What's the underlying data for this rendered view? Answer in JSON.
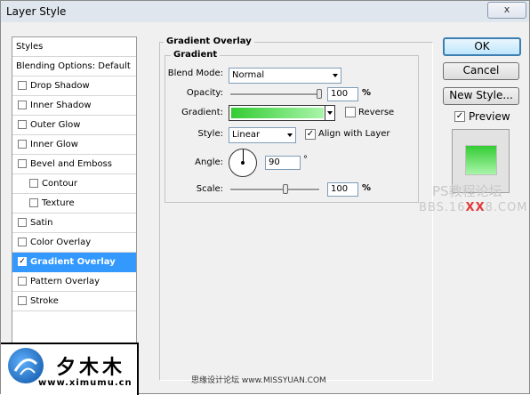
{
  "window": {
    "title": "Layer Style",
    "close_glyph": "x"
  },
  "styles_panel": {
    "items": [
      {
        "label": "Styles",
        "checkbox": false
      },
      {
        "label": "Blending Options: Default",
        "checkbox": false
      },
      {
        "label": "Drop Shadow",
        "checkbox": true,
        "checked": false
      },
      {
        "label": "Inner Shadow",
        "checkbox": true,
        "checked": false
      },
      {
        "label": "Outer Glow",
        "checkbox": true,
        "checked": false
      },
      {
        "label": "Inner Glow",
        "checkbox": true,
        "checked": false
      },
      {
        "label": "Bevel and Emboss",
        "checkbox": true,
        "checked": false
      },
      {
        "label": "Contour",
        "checkbox": true,
        "checked": false,
        "indent": true
      },
      {
        "label": "Texture",
        "checkbox": true,
        "checked": false,
        "indent": true
      },
      {
        "label": "Satin",
        "checkbox": true,
        "checked": false
      },
      {
        "label": "Color Overlay",
        "checkbox": true,
        "checked": false
      },
      {
        "label": "Gradient Overlay",
        "checkbox": true,
        "checked": true,
        "selected": true
      },
      {
        "label": "Pattern Overlay",
        "checkbox": true,
        "checked": false
      },
      {
        "label": "Stroke",
        "checkbox": true,
        "checked": false
      }
    ]
  },
  "gradient_overlay": {
    "section_title": "Gradient Overlay",
    "group_title": "Gradient",
    "blend_mode_label": "Blend Mode:",
    "blend_mode_value": "Normal",
    "opacity_label": "Opacity:",
    "opacity_value": "100",
    "opacity_unit": "%",
    "opacity_level": 1.0,
    "gradient_label": "Gradient:",
    "gradient_colors": [
      "#33cc33",
      "#aaf5aa"
    ],
    "reverse_label": "Reverse",
    "reverse_checked": false,
    "style_label": "Style:",
    "style_value": "Linear",
    "align_label": "Align with Layer",
    "align_checked": true,
    "angle_label": "Angle:",
    "angle_value": "90",
    "angle_unit": "°",
    "scale_label": "Scale:",
    "scale_value": "100",
    "scale_unit": "%",
    "scale_level": 0.62
  },
  "buttons": {
    "ok": "OK",
    "cancel": "Cancel",
    "new_style": "New Style..."
  },
  "preview": {
    "label": "Preview",
    "checked": true
  },
  "watermarks": {
    "line1": "PS教程论坛",
    "line2_pre": "BBS.16",
    "line2_mid": "XX",
    "line2_post": "8.COM"
  },
  "branding": {
    "name": "夕木木",
    "url": "www.ximumu.cn",
    "footer": "思缘设计论坛 www.MISSYUAN.COM"
  }
}
